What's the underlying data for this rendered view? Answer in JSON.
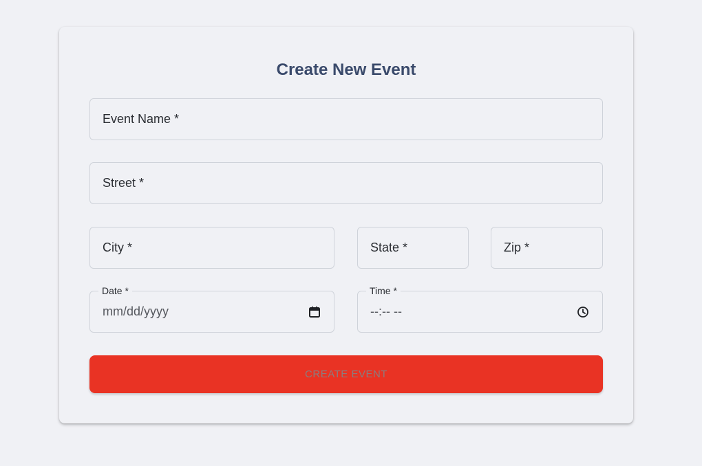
{
  "form": {
    "title": "Create New Event",
    "event_name_label": "Event Name *",
    "street_label": "Street *",
    "city_label": "City *",
    "state_label": "State *",
    "zip_label": "Zip *",
    "date_label": "Date *",
    "date_placeholder": "mm/dd/yyyy",
    "time_label": "Time *",
    "time_placeholder": "--:-- --",
    "submit_label": "CREATE EVENT"
  },
  "icons": {
    "date": "calendar-icon",
    "time": "clock-icon"
  },
  "colors": {
    "title": "#3a4a6b",
    "button": "#e93324",
    "background": "#f0f1f5"
  }
}
